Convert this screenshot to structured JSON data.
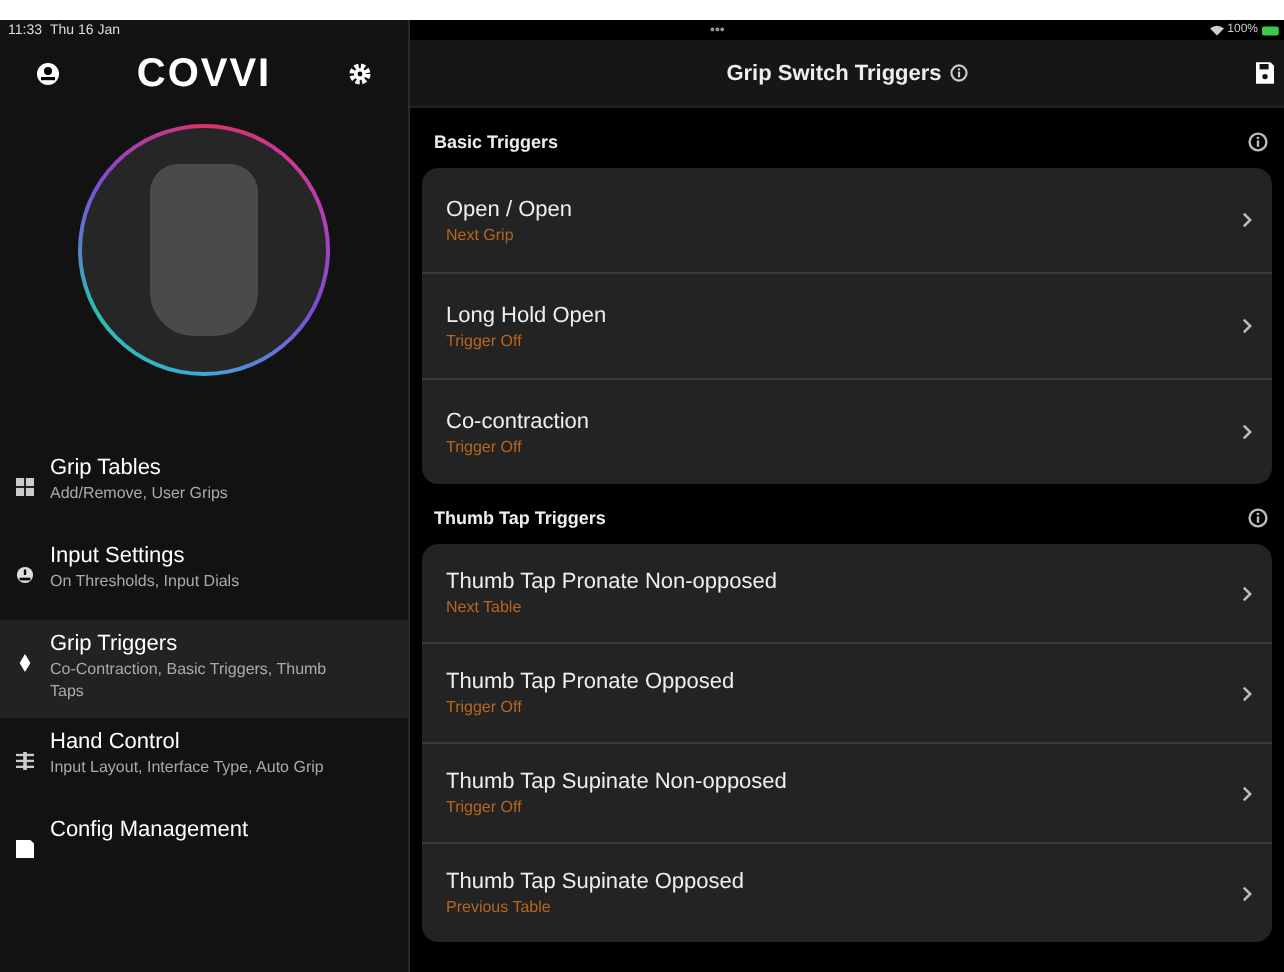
{
  "status_bar": {
    "time": "11:33",
    "date": "Thu 16 Jan",
    "dots": "•••",
    "battery": "100%"
  },
  "sidebar": {
    "logo": "COVVI",
    "items": [
      {
        "kind": "table",
        "title": "Grip Tables",
        "subtitle": "Add/Remove, User Grips",
        "selected": false
      },
      {
        "kind": "dial",
        "title": "Input Settings",
        "subtitle": "On Thresholds, Input Dials",
        "selected": false
      },
      {
        "kind": "trigger",
        "title": "Grip Triggers",
        "subtitle": "Co-Contraction, Basic Triggers, Thumb Taps",
        "selected": true
      },
      {
        "kind": "control",
        "title": "Hand Control",
        "subtitle": "Input Layout, Interface Type, Auto Grip",
        "selected": false
      },
      {
        "kind": "config",
        "title": "Config Management",
        "selected": false
      }
    ]
  },
  "header": {
    "title": "Grip Switch Triggers"
  },
  "sections": [
    {
      "title": "Basic Triggers",
      "rows": [
        {
          "title": "Open / Open",
          "value": "Next Grip"
        },
        {
          "title": "Long Hold Open",
          "value": "Trigger Off"
        },
        {
          "title": "Co-contraction",
          "value": "Trigger Off"
        }
      ]
    },
    {
      "title": "Thumb Tap Triggers",
      "rows": [
        {
          "title": "Thumb Tap Pronate Non-opposed",
          "value": "Next Table"
        },
        {
          "title": "Thumb Tap Pronate Opposed",
          "value": "Trigger Off"
        },
        {
          "title": "Thumb Tap Supinate Non-opposed",
          "value": "Trigger Off"
        },
        {
          "title": "Thumb Tap Supinate Opposed",
          "value": "Previous Table"
        }
      ]
    }
  ]
}
